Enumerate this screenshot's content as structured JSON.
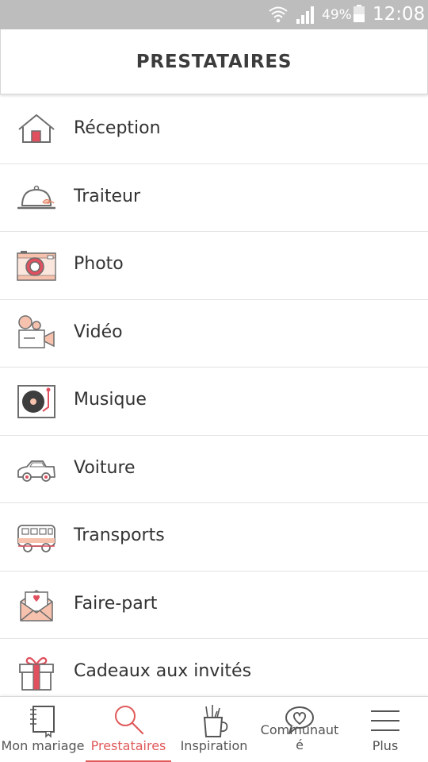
{
  "status_bar": {
    "battery_percent": "49%",
    "time": "12:08"
  },
  "header": {
    "title": "PRESTATAIRES"
  },
  "categories": [
    {
      "label": "Réception",
      "icon": "house-icon"
    },
    {
      "label": "Traiteur",
      "icon": "cloche-icon"
    },
    {
      "label": "Photo",
      "icon": "camera-icon"
    },
    {
      "label": "Vidéo",
      "icon": "video-camera-icon"
    },
    {
      "label": "Musique",
      "icon": "turntable-icon"
    },
    {
      "label": "Voiture",
      "icon": "car-icon"
    },
    {
      "label": "Transports",
      "icon": "bus-icon"
    },
    {
      "label": "Faire-part",
      "icon": "envelope-heart-icon"
    },
    {
      "label": "Cadeaux aux invités",
      "icon": "gift-icon"
    }
  ],
  "bottom_nav": {
    "items": [
      {
        "label": "Mon mariage",
        "icon": "notebook-icon",
        "active": false
      },
      {
        "label": "Prestataires",
        "icon": "search-icon",
        "active": true
      },
      {
        "label": "Inspiration",
        "icon": "pencil-cup-icon",
        "active": false
      },
      {
        "label": "Communauté",
        "label_line1": "Communaut",
        "label_line2": "é",
        "icon": "chat-heart-icon",
        "active": false
      },
      {
        "label": "Plus",
        "icon": "menu-icon",
        "active": false
      }
    ]
  },
  "colors": {
    "accent": "#e05a5a",
    "icon_line": "#6d6d6d",
    "icon_fill_pink": "#f6c2ae",
    "icon_fill_red": "#e0505e",
    "status_bar": "#bdbdbd"
  }
}
